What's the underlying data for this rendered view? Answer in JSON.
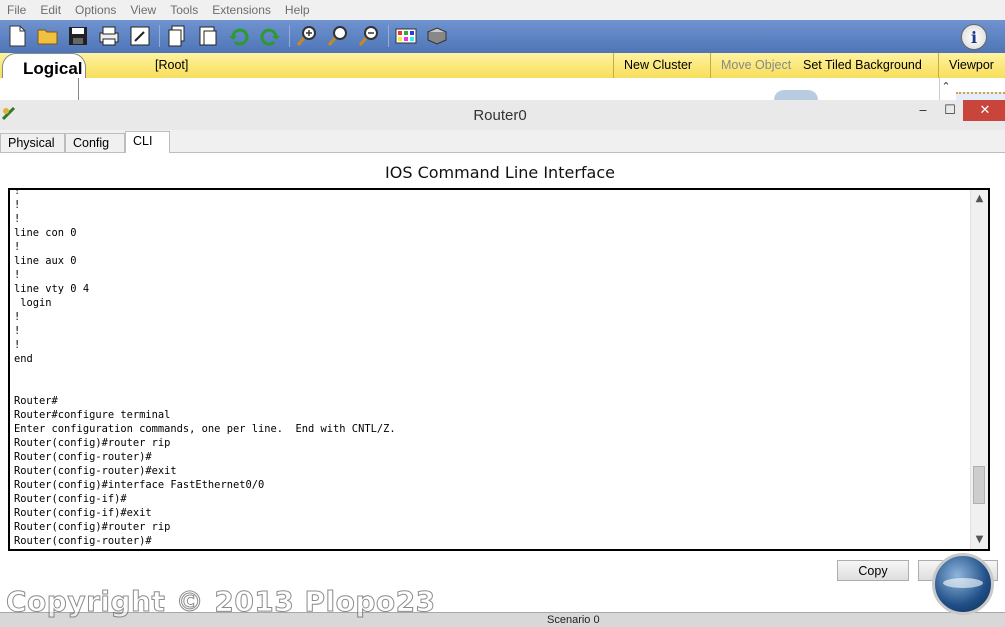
{
  "menu": [
    "File",
    "Edit",
    "Options",
    "View",
    "Tools",
    "Extensions",
    "Help"
  ],
  "toolbar": {
    "icons": [
      "new-file-icon",
      "open-folder-icon",
      "save-icon",
      "print-icon",
      "activity-wizard-icon",
      "copy-icon",
      "paste-icon",
      "undo-icon",
      "redo-icon",
      "zoom-in-icon",
      "zoom-reset-icon",
      "zoom-out-icon",
      "palette-icon",
      "custom-device-icon",
      "info-icon"
    ],
    "info_glyph": "i"
  },
  "logical_bar": {
    "tab_label": "Logical",
    "root_label": "[Root]",
    "new_cluster": "New Cluster",
    "move_object": "Move Object",
    "set_tiled_background": "Set Tiled Background",
    "viewport": "Viewpor"
  },
  "window": {
    "title": "Router0",
    "controls": {
      "minimize": "‒",
      "maximize": "☐",
      "close": "✕"
    }
  },
  "tabs": [
    "Physical",
    "Config",
    "CLI"
  ],
  "active_tab": "CLI",
  "cli": {
    "heading": "IOS Command Line Interface",
    "lines": [
      "!",
      "!",
      "!",
      "line con 0",
      "!",
      "line aux 0",
      "!",
      "line vty 0 4",
      " login",
      "!",
      "!",
      "!",
      "end",
      "",
      "",
      "Router#",
      "Router#configure terminal",
      "Enter configuration commands, one per line.  End with CNTL/Z.",
      "Router(config)#router rip",
      "Router(config-router)#",
      "Router(config-router)#exit",
      "Router(config)#interface FastEthernet0/0",
      "Router(config-if)#",
      "Router(config-if)#exit",
      "Router(config)#router rip",
      "Router(config-router)#"
    ],
    "scroll_position": 0.9
  },
  "buttons": {
    "copy": "Copy"
  },
  "status": {
    "scenario": "Scenario 0"
  },
  "watermark": "Copyright © 2013  Plopo23",
  "colors": {
    "toolbar": "#5a7fc0",
    "logical_bar": "#f7de5a",
    "close_button": "#c9453c"
  }
}
